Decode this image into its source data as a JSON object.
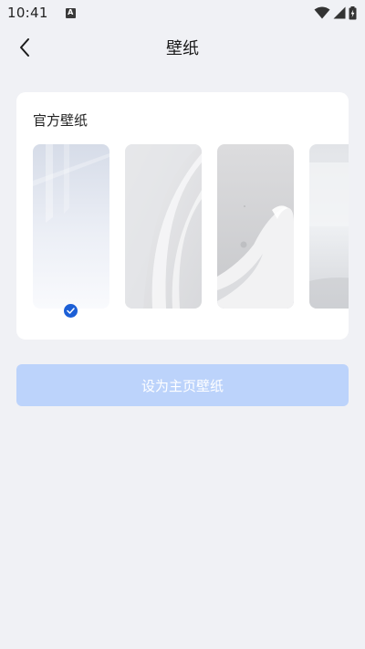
{
  "status_bar": {
    "time": "10:41",
    "notification_icon": "a-notification-icon",
    "indicators": [
      "wifi-icon",
      "signal-icon",
      "battery-charging-icon"
    ]
  },
  "header": {
    "back_icon": "chevron-left-icon",
    "title": "壁纸"
  },
  "wallpaper_section": {
    "title": "官方壁纸",
    "items": [
      {
        "name": "wallpaper-1",
        "selected": true
      },
      {
        "name": "wallpaper-2",
        "selected": false
      },
      {
        "name": "wallpaper-3",
        "selected": false
      },
      {
        "name": "wallpaper-4",
        "selected": false
      }
    ]
  },
  "actions": {
    "set_home_wallpaper_label": "设为主页壁纸",
    "set_home_wallpaper_enabled": false
  },
  "colors": {
    "background": "#f0f1f5",
    "accent": "#1c5fd6",
    "button_disabled": "#bcd3fb"
  }
}
